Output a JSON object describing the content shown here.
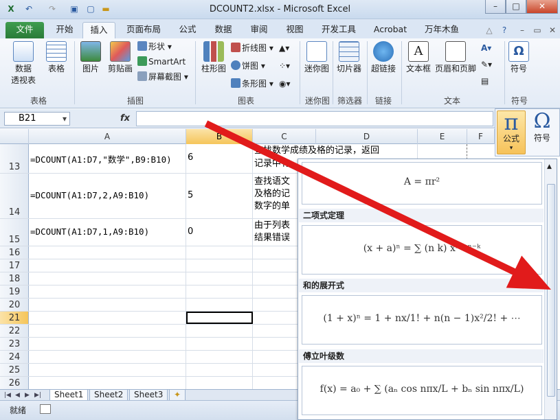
{
  "window": {
    "title": "DCOUNT2.xlsx - Microsoft Excel",
    "min": "–",
    "max": "□",
    "close": "✕"
  },
  "tabs": [
    "文件",
    "开始",
    "插入",
    "页面布局",
    "公式",
    "数据",
    "审阅",
    "视图",
    "开发工具",
    "Acrobat",
    "万年木鱼"
  ],
  "ribbon": {
    "groups": {
      "table": "表格",
      "illust": "插图",
      "charts": "图表",
      "spark": "迷你图",
      "filter": "筛选器",
      "links": "链接",
      "text": "文本",
      "symbols": "符号"
    },
    "buttons": {
      "pivot": "数据\n透视表",
      "table": "表格",
      "picture": "图片",
      "clipart": "剪贴画",
      "shapes": "形状",
      "smartart": "SmartArt",
      "screenshot": "屏幕截图",
      "column": "柱形图",
      "line": "折线图",
      "pie": "饼图",
      "bar": "条形图",
      "sparkline": "迷你图",
      "slicer": "切片器",
      "hyperlink": "超链接",
      "textbox": "文本框",
      "headerfooter": "页眉和页脚",
      "symbol": "符号"
    }
  },
  "formula_bar": {
    "name": "B21",
    "fx": "fx",
    "value": ""
  },
  "columns": [
    "A",
    "B",
    "C",
    "D",
    "E",
    "F"
  ],
  "rows": [
    {
      "n": "13",
      "a": "=DCOUNT(A1:D7,\"数学\",B9:B10)",
      "b": "6",
      "c1": "查找数学成绩及格的记录，返回",
      "c2": "记录中有"
    },
    {
      "n": "14",
      "a": "=DCOUNT(A1:D7,2,A9:B10)",
      "b": "5",
      "c1": "查找语文",
      "c2": "及格的记",
      "c3": "数字的单"
    },
    {
      "n": "15",
      "a": "=DCOUNT(A1:D7,1,A9:B10)",
      "b": "0",
      "c1": "由于列表",
      "c2": "结果错误"
    },
    {
      "n": "16"
    },
    {
      "n": "17"
    },
    {
      "n": "18"
    },
    {
      "n": "19"
    },
    {
      "n": "20"
    },
    {
      "n": "21"
    },
    {
      "n": "22"
    },
    {
      "n": "23"
    },
    {
      "n": "24"
    },
    {
      "n": "25"
    },
    {
      "n": "26"
    }
  ],
  "sheets": [
    "Sheet1",
    "Sheet2",
    "Sheet3"
  ],
  "status": "就绪",
  "equation": {
    "btn": "公式",
    "symbol": "符号",
    "pi": "π",
    "omega": "Ω"
  },
  "eq_panel": [
    {
      "title": "",
      "formula": "A = πr²"
    },
    {
      "title": "二项式定理",
      "formula": "(x + a)ⁿ = ∑ (n k) xᵏ aⁿ⁻ᵏ"
    },
    {
      "title": "和的展开式",
      "formula": "(1 + x)ⁿ = 1 + nx/1! + n(n − 1)x²/2! + ⋯"
    },
    {
      "title": "傅立叶级数",
      "formula": "f(x) = a₀ + ∑ (aₙ cos nπx/L + bₙ sin nπx/L)"
    }
  ],
  "colors": {
    "accent": "#2a7b38",
    "arrow": "#e11b1b",
    "selhdr": "#f5c55a"
  }
}
